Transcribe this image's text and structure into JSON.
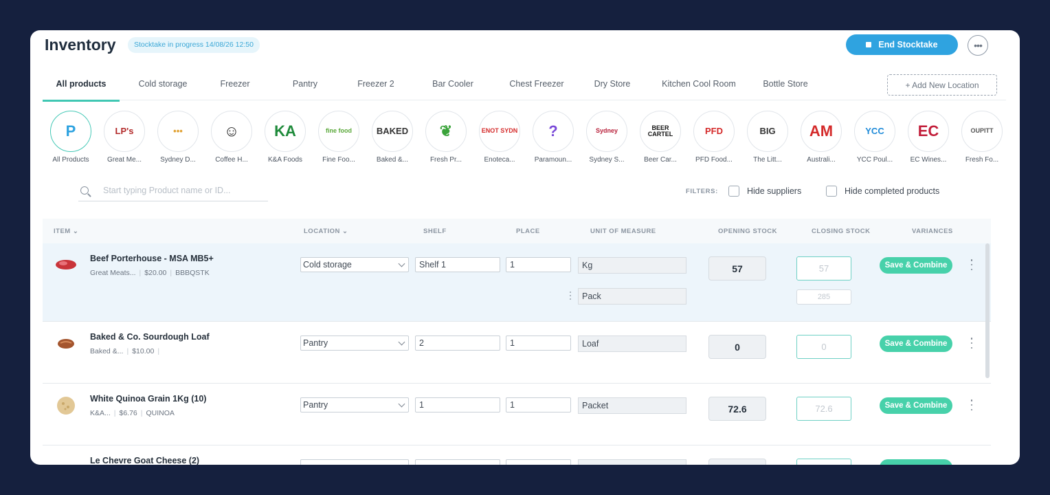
{
  "header": {
    "title": "Inventory",
    "status": "Stocktake in progress 14/08/26 12:50",
    "end_button": "End Stocktake",
    "more_label": "•••"
  },
  "tabs": [
    {
      "label": "All products",
      "active": true
    },
    {
      "label": "Cold storage"
    },
    {
      "label": "Freezer"
    },
    {
      "label": "Pantry"
    },
    {
      "label": "Freezer 2"
    },
    {
      "label": "Bar Cooler"
    },
    {
      "label": "Chest Freezer"
    },
    {
      "label": "Dry Store"
    },
    {
      "label": "Kitchen Cool Room"
    },
    {
      "label": "Bottle Store"
    }
  ],
  "add_location": "+ Add New Location",
  "suppliers": [
    {
      "label": "All Products",
      "logo_text": "P",
      "color": "#2fa3e0",
      "active": true
    },
    {
      "label": "Great Me...",
      "logo_text": "LP's",
      "color": "#b22a2a"
    },
    {
      "label": "Sydney D...",
      "logo_text": "•••",
      "color": "#e0a030"
    },
    {
      "label": "Coffee H...",
      "logo_text": "☺",
      "color": "#222222"
    },
    {
      "label": "K&A Foods",
      "logo_text": "KA",
      "color": "#1e8a3a"
    },
    {
      "label": "Fine Foo...",
      "logo_text": "fine food",
      "color": "#5aa83a"
    },
    {
      "label": "Baked &...",
      "logo_text": "BAKED",
      "color": "#333333"
    },
    {
      "label": "Fresh Pr...",
      "logo_text": "❦",
      "color": "#3aa33a"
    },
    {
      "label": "Enoteca...",
      "logo_text": "ENOT SYDN",
      "color": "#d42a2a"
    },
    {
      "label": "Paramoun...",
      "logo_text": "?",
      "color": "#7a4ad8"
    },
    {
      "label": "Sydney S...",
      "logo_text": "Sydney",
      "color": "#b8203a"
    },
    {
      "label": "Beer Car...",
      "logo_text": "BEER CARTEL",
      "color": "#111111"
    },
    {
      "label": "PFD Food...",
      "logo_text": "PFD",
      "color": "#d42a2a"
    },
    {
      "label": "The Litt...",
      "logo_text": "BIG",
      "color": "#333333"
    },
    {
      "label": "Australi...",
      "logo_text": "AM",
      "color": "#d42a2a"
    },
    {
      "label": "YCC Poul...",
      "logo_text": "YCC",
      "color": "#1e8ad8"
    },
    {
      "label": "EC Wines...",
      "logo_text": "EC",
      "color": "#c21e3a"
    },
    {
      "label": "Fresh Fo...",
      "logo_text": "OUPITT",
      "color": "#555555"
    }
  ],
  "search": {
    "placeholder": "Start typing Product name or ID..."
  },
  "filters": {
    "label": "FILTERS:",
    "hide_suppliers": "Hide suppliers",
    "hide_completed": "Hide completed products"
  },
  "table": {
    "headers": {
      "item": "ITEM ⌄",
      "location": "LOCATION ⌄",
      "shelf": "SHELF",
      "place": "PLACE",
      "unit": "UNIT OF MEASURE",
      "opening": "OPENING STOCK",
      "closing": "CLOSING STOCK",
      "variances": "VARIANCES"
    },
    "save_label": "Save & Combine",
    "rows": [
      {
        "name": "Beef Porterhouse - MSA MB5+",
        "supplier": "Great Meats...",
        "price": "$20.00",
        "code": "BBBQSTK",
        "location": "Cold storage",
        "shelf": "Shelf 1",
        "place": "1",
        "unit": "Kg",
        "unit2": "Pack",
        "opening": "57",
        "closing": "57",
        "closing2": "285"
      },
      {
        "name": "Baked & Co. Sourdough Loaf",
        "supplier": "Baked &...",
        "price": "$10.00",
        "code": "",
        "location": "Pantry",
        "shelf": "2",
        "place": "1",
        "unit": "Loaf",
        "opening": "0",
        "closing": "0"
      },
      {
        "name": "White Quinoa Grain 1Kg (10)",
        "supplier": "K&A...",
        "price": "$6.76",
        "code": "QUINOA",
        "location": "Pantry",
        "shelf": "1",
        "place": "1",
        "unit": "Packet",
        "opening": "72.6",
        "closing": "72.6"
      },
      {
        "name": "Le Chevre Goat Cheese (2)"
      }
    ]
  },
  "colors": {
    "background": "#15203e",
    "accent": "#2fa3e0",
    "save_button": "#47d1aa",
    "tab_underline": "#40c7b3"
  }
}
